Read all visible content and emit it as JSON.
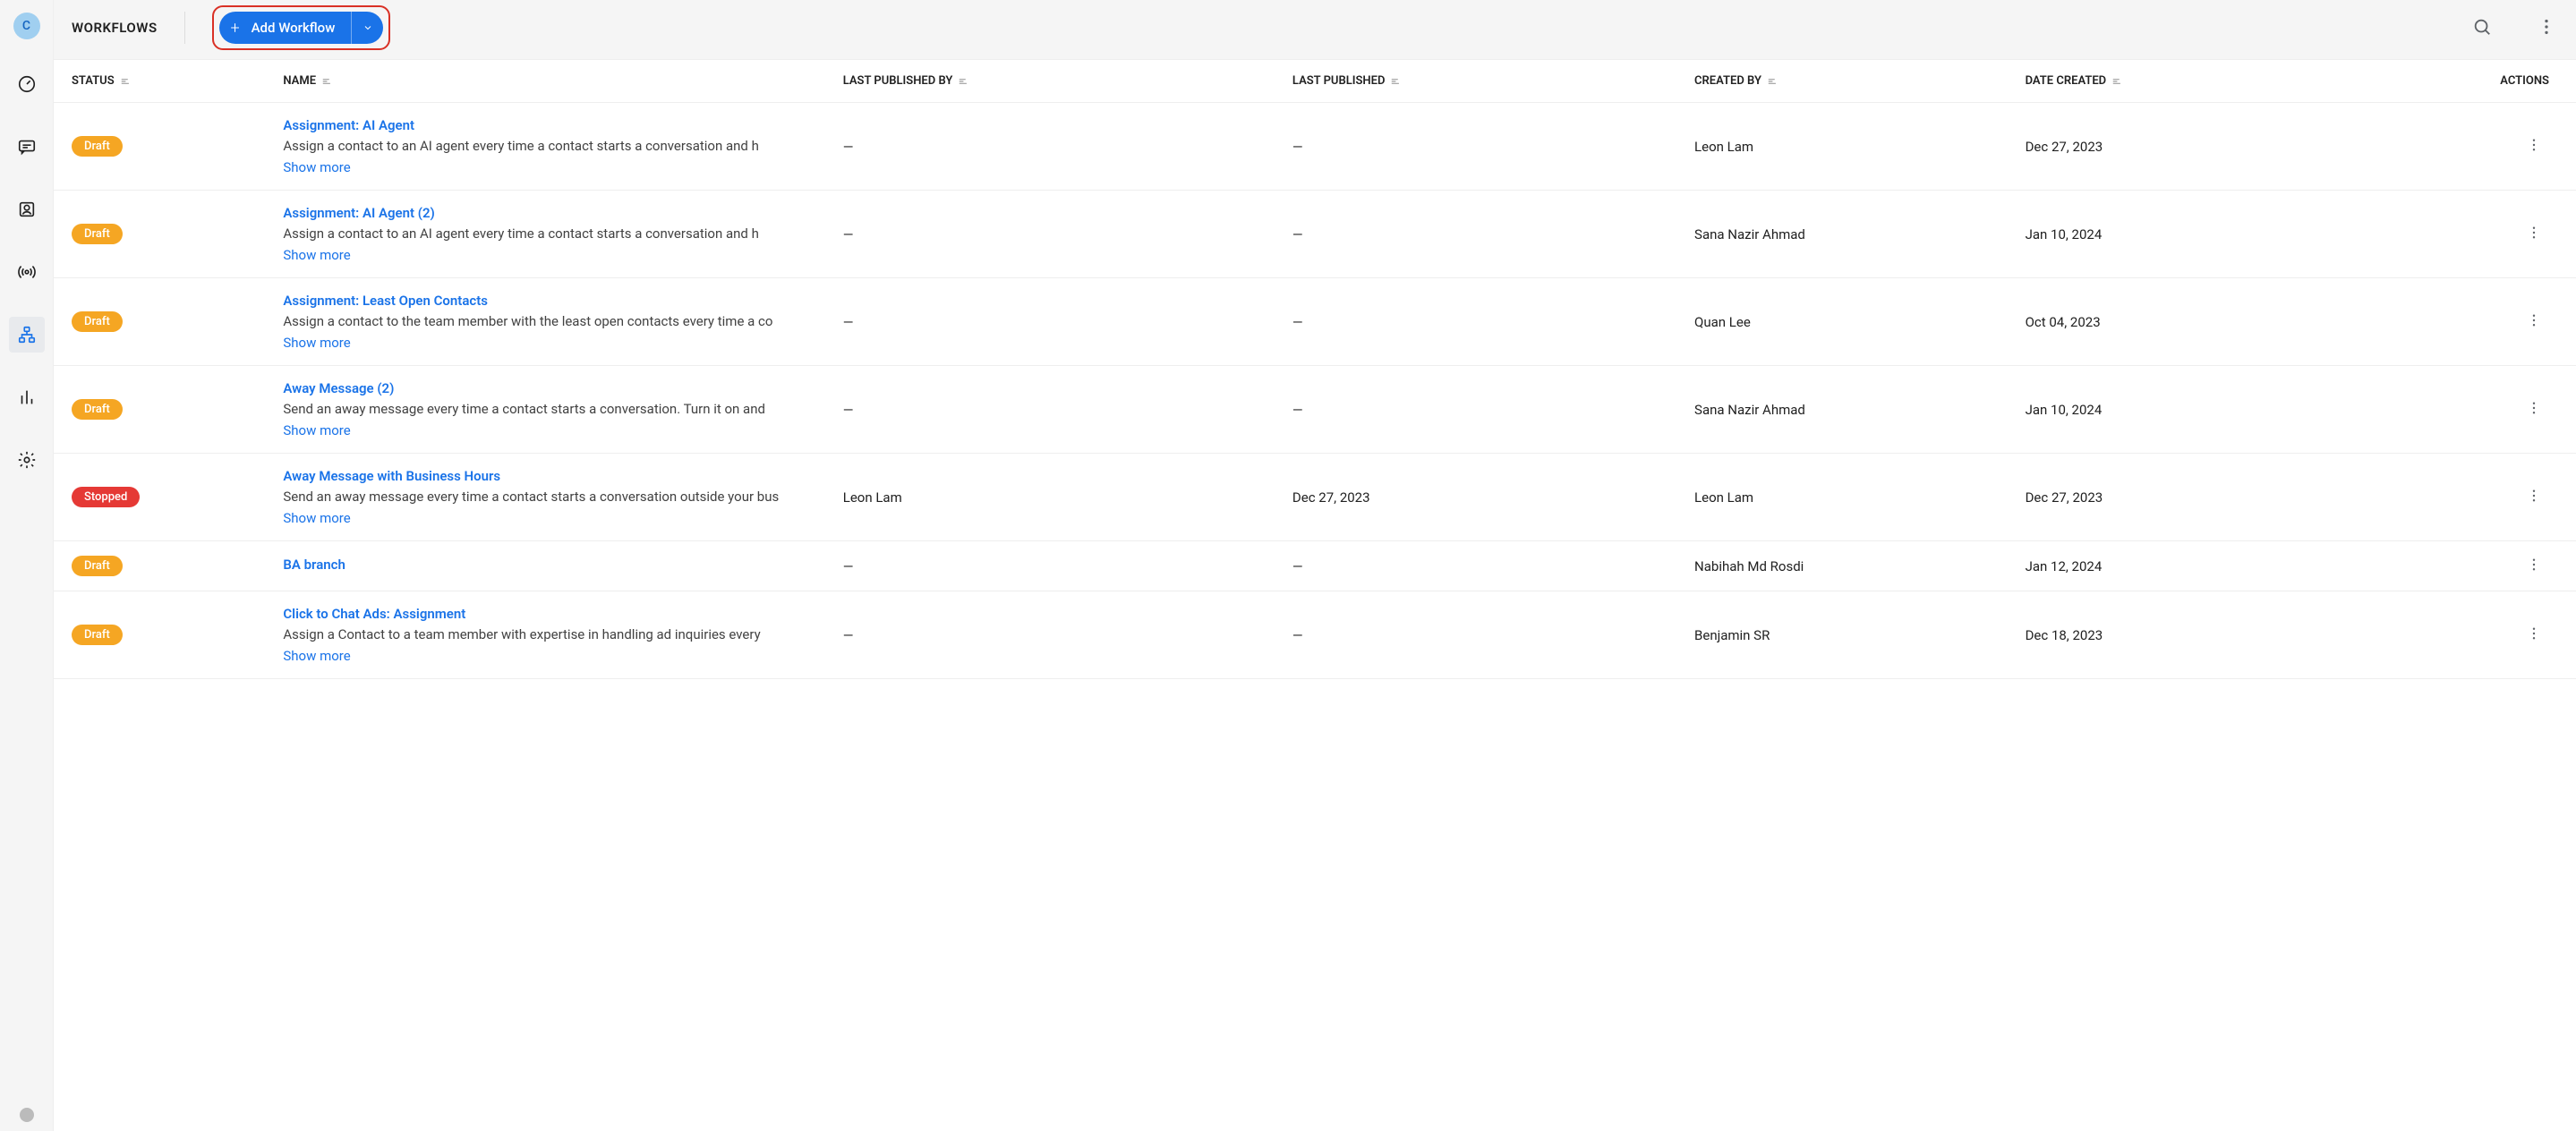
{
  "org_initial": "C",
  "header": {
    "title": "WORKFLOWS",
    "add_label": "Add Workflow"
  },
  "columns": {
    "status": "STATUS",
    "name": "NAME",
    "last_published_by": "LAST PUBLISHED BY",
    "last_published": "LAST PUBLISHED",
    "created_by": "CREATED BY",
    "date_created": "DATE CREATED",
    "actions": "ACTIONS"
  },
  "show_more_label": "Show more",
  "rows": [
    {
      "status": "Draft",
      "status_class": "draft",
      "name": "Assignment: AI Agent",
      "desc": "Assign a contact to an AI agent every time a contact starts a conversation and h",
      "show_more": true,
      "last_published_by": "—",
      "last_published": "—",
      "created_by": "Leon Lam",
      "date_created": "Dec 27, 2023"
    },
    {
      "status": "Draft",
      "status_class": "draft",
      "name": "Assignment: AI Agent (2)",
      "desc": "Assign a contact to an AI agent every time a contact starts a conversation and h",
      "show_more": true,
      "last_published_by": "—",
      "last_published": "—",
      "created_by": "Sana Nazir Ahmad",
      "date_created": "Jan 10, 2024"
    },
    {
      "status": "Draft",
      "status_class": "draft",
      "name": "Assignment: Least Open Contacts",
      "desc": "Assign a contact to the team member with the least open contacts every time a co",
      "show_more": true,
      "last_published_by": "—",
      "last_published": "—",
      "created_by": "Quan Lee",
      "date_created": "Oct 04, 2023"
    },
    {
      "status": "Draft",
      "status_class": "draft",
      "name": "Away Message (2)",
      "desc": "Send an away message every time a contact starts a conversation. Turn it on and",
      "show_more": true,
      "last_published_by": "—",
      "last_published": "—",
      "created_by": "Sana Nazir Ahmad",
      "date_created": "Jan 10, 2024"
    },
    {
      "status": "Stopped",
      "status_class": "stopped",
      "name": "Away Message with Business Hours",
      "desc": "Send an away message every time a contact starts a conversation outside your bus",
      "show_more": true,
      "last_published_by": "Leon Lam",
      "last_published": "Dec 27, 2023",
      "created_by": "Leon Lam",
      "date_created": "Dec 27, 2023"
    },
    {
      "status": "Draft",
      "status_class": "draft",
      "name": "BA branch",
      "desc": "",
      "show_more": false,
      "last_published_by": "—",
      "last_published": "—",
      "created_by": "Nabihah Md Rosdi",
      "date_created": "Jan 12, 2024"
    },
    {
      "status": "Draft",
      "status_class": "draft",
      "name": "Click to Chat Ads: Assignment",
      "desc": "Assign a Contact to a team member with expertise in handling ad inquiries every",
      "show_more": true,
      "last_published_by": "—",
      "last_published": "—",
      "created_by": "Benjamin SR",
      "date_created": "Dec 18, 2023"
    }
  ]
}
